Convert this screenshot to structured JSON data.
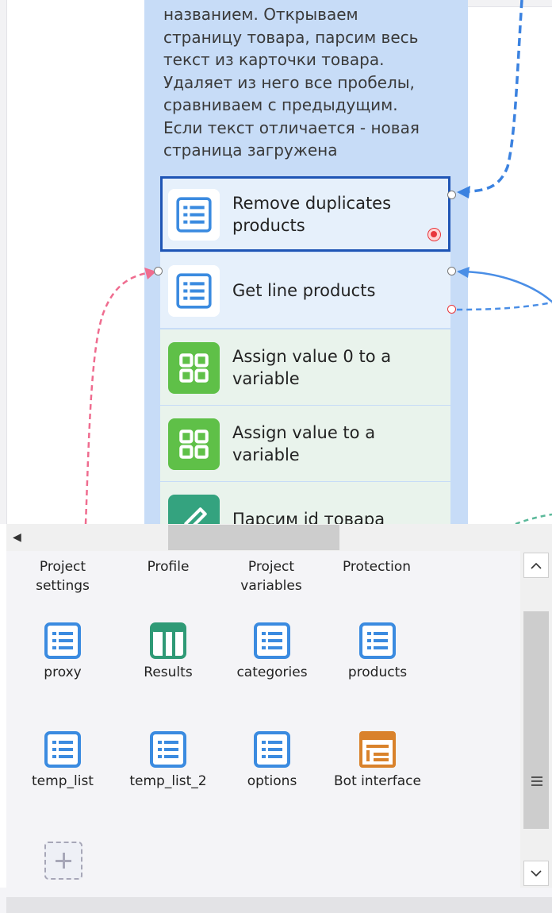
{
  "group": {
    "comment": "названием. Открываем\nстраницу товара, парсим весь\nтекст из карточки товара.\nУдаляет из него все пробелы,\nсравниваем с предыдущим.\nЕсли текст отличается - новая\nстраница загружена"
  },
  "nodes": [
    {
      "label": "Remove duplicates products",
      "icon": "list-icon",
      "selected": true
    },
    {
      "label": "Get line products",
      "icon": "list-icon"
    },
    {
      "label": "Assign value 0 to a variable",
      "icon": "variable-icon"
    },
    {
      "label": "Assign value  to a variable",
      "icon": "variable-icon"
    },
    {
      "label": "Парсим id товара",
      "icon": "pencil-icon"
    }
  ],
  "panel": {
    "headers": [
      "Project settings",
      "Profile",
      "Project variables",
      "Protection"
    ],
    "items": [
      {
        "label": "proxy",
        "icon": "list-icon"
      },
      {
        "label": "Results",
        "icon": "table-icon"
      },
      {
        "label": "categories",
        "icon": "list-icon"
      },
      {
        "label": "products",
        "icon": "list-icon"
      },
      {
        "label": "temp_list",
        "icon": "list-icon"
      },
      {
        "label": "temp_list_2",
        "icon": "list-icon"
      },
      {
        "label": "options",
        "icon": "list-icon"
      },
      {
        "label": "Bot interface",
        "icon": "bot-interface-icon"
      }
    ]
  },
  "colors": {
    "group_bg": "#c7dcf7",
    "selected_border": "#1f55b5",
    "list_icon": "#3b8be0",
    "variable_icon": "#5fc048",
    "pencil_icon": "#34a37f",
    "table_icon": "#2f9a76",
    "bot_icon": "#d9822b",
    "link_blue": "#3b82e0",
    "link_pink": "#ef6c8f",
    "link_green": "#5bb99a"
  }
}
